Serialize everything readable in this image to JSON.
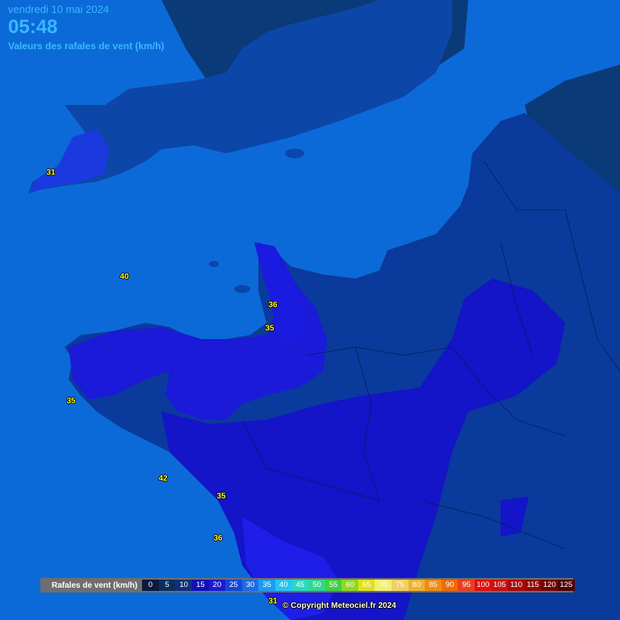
{
  "header": {
    "date": "vendredi 10 mai 2024",
    "time": "05:48",
    "subtitle": "Valeurs des rafales de vent (km/h)"
  },
  "station_values": [
    "31",
    "40",
    "36",
    "35",
    "35",
    "42",
    "35",
    "36",
    "31"
  ],
  "legend": {
    "title": "Rafales de vent (km/h)",
    "items": [
      {
        "label": "0",
        "color": "#0a1a40"
      },
      {
        "label": "5",
        "color": "#0d2e5c"
      },
      {
        "label": "10",
        "color": "#10307a"
      },
      {
        "label": "15",
        "color": "#1010b8"
      },
      {
        "label": "20",
        "color": "#1a1ad0"
      },
      {
        "label": "25",
        "color": "#1446d8"
      },
      {
        "label": "30",
        "color": "#1e6ae8"
      },
      {
        "label": "35",
        "color": "#1e9cf0"
      },
      {
        "label": "40",
        "color": "#28c4f0"
      },
      {
        "label": "45",
        "color": "#2ad8c0"
      },
      {
        "label": "50",
        "color": "#30d890"
      },
      {
        "label": "55",
        "color": "#40d040"
      },
      {
        "label": "60",
        "color": "#90d820"
      },
      {
        "label": "65",
        "color": "#e0e020"
      },
      {
        "label": "70",
        "color": "#f0f070"
      },
      {
        "label": "75",
        "color": "#f0d060"
      },
      {
        "label": "80",
        "color": "#f0b030"
      },
      {
        "label": "85",
        "color": "#f08c10"
      },
      {
        "label": "90",
        "color": "#f06a00"
      },
      {
        "label": "95",
        "color": "#e84020"
      },
      {
        "label": "100",
        "color": "#e01010"
      },
      {
        "label": "105",
        "color": "#c81010"
      },
      {
        "label": "110",
        "color": "#a80a0a"
      },
      {
        "label": "115",
        "color": "#900808"
      },
      {
        "label": "120",
        "color": "#700404"
      },
      {
        "label": "125",
        "color": "#500000"
      }
    ]
  },
  "copyright": "© Copyright Meteociel.fr 2024"
}
